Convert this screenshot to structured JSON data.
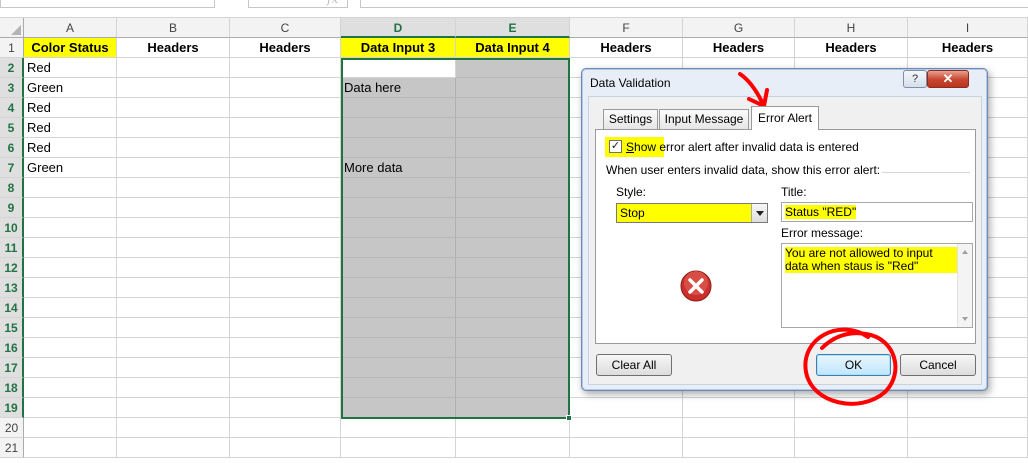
{
  "formula_bar": {
    "fx_symbol": "fx"
  },
  "columns": [
    {
      "letter": "A",
      "header": "Color Status"
    },
    {
      "letter": "B",
      "header": "Headers"
    },
    {
      "letter": "C",
      "header": "Headers"
    },
    {
      "letter": "D",
      "header": "Data Input 3"
    },
    {
      "letter": "E",
      "header": "Data Input 4"
    },
    {
      "letter": "F",
      "header": "Headers"
    },
    {
      "letter": "G",
      "header": "Headers"
    },
    {
      "letter": "H",
      "header": "Headers"
    },
    {
      "letter": "I",
      "header": "Headers"
    }
  ],
  "rows": [
    "1",
    "2",
    "3",
    "4",
    "5",
    "6",
    "7",
    "8",
    "9",
    "10",
    "11",
    "12",
    "13",
    "14",
    "15",
    "16",
    "17",
    "18",
    "19",
    "20",
    "21"
  ],
  "column_a_values": [
    "Red",
    "Green",
    "Red",
    "Red",
    "Red",
    "Green"
  ],
  "column_d_values": {
    "row3": "Data here",
    "row7": "More data"
  },
  "colors": {
    "highlight": "#ffff00",
    "selection": "#217346",
    "range_fill": "#c6c6c6",
    "annotation": "#ff0000"
  },
  "dialog": {
    "title": "Data Validation",
    "help_label": "?",
    "close_label": "✕",
    "tabs": [
      "Settings",
      "Input Message",
      "Error Alert"
    ],
    "active_tab": "Error Alert",
    "show_alert_checked": true,
    "show_alert_label_underlined": "S",
    "show_alert_label_rest": "how error alert after invalid data is entered",
    "instruction": "When user enters invalid data, show this error alert:",
    "style_label": "Style:",
    "style_value": "Stop",
    "title_label": "Title:",
    "title_value": "Status \"RED\"",
    "error_message_label": "Error message:",
    "error_message_value": "You are not allowed to input data when staus is \"Red\"",
    "icon": "error-x-icon",
    "clear_all_label": "Clear All",
    "ok_label": "OK",
    "cancel_label": "Cancel"
  }
}
